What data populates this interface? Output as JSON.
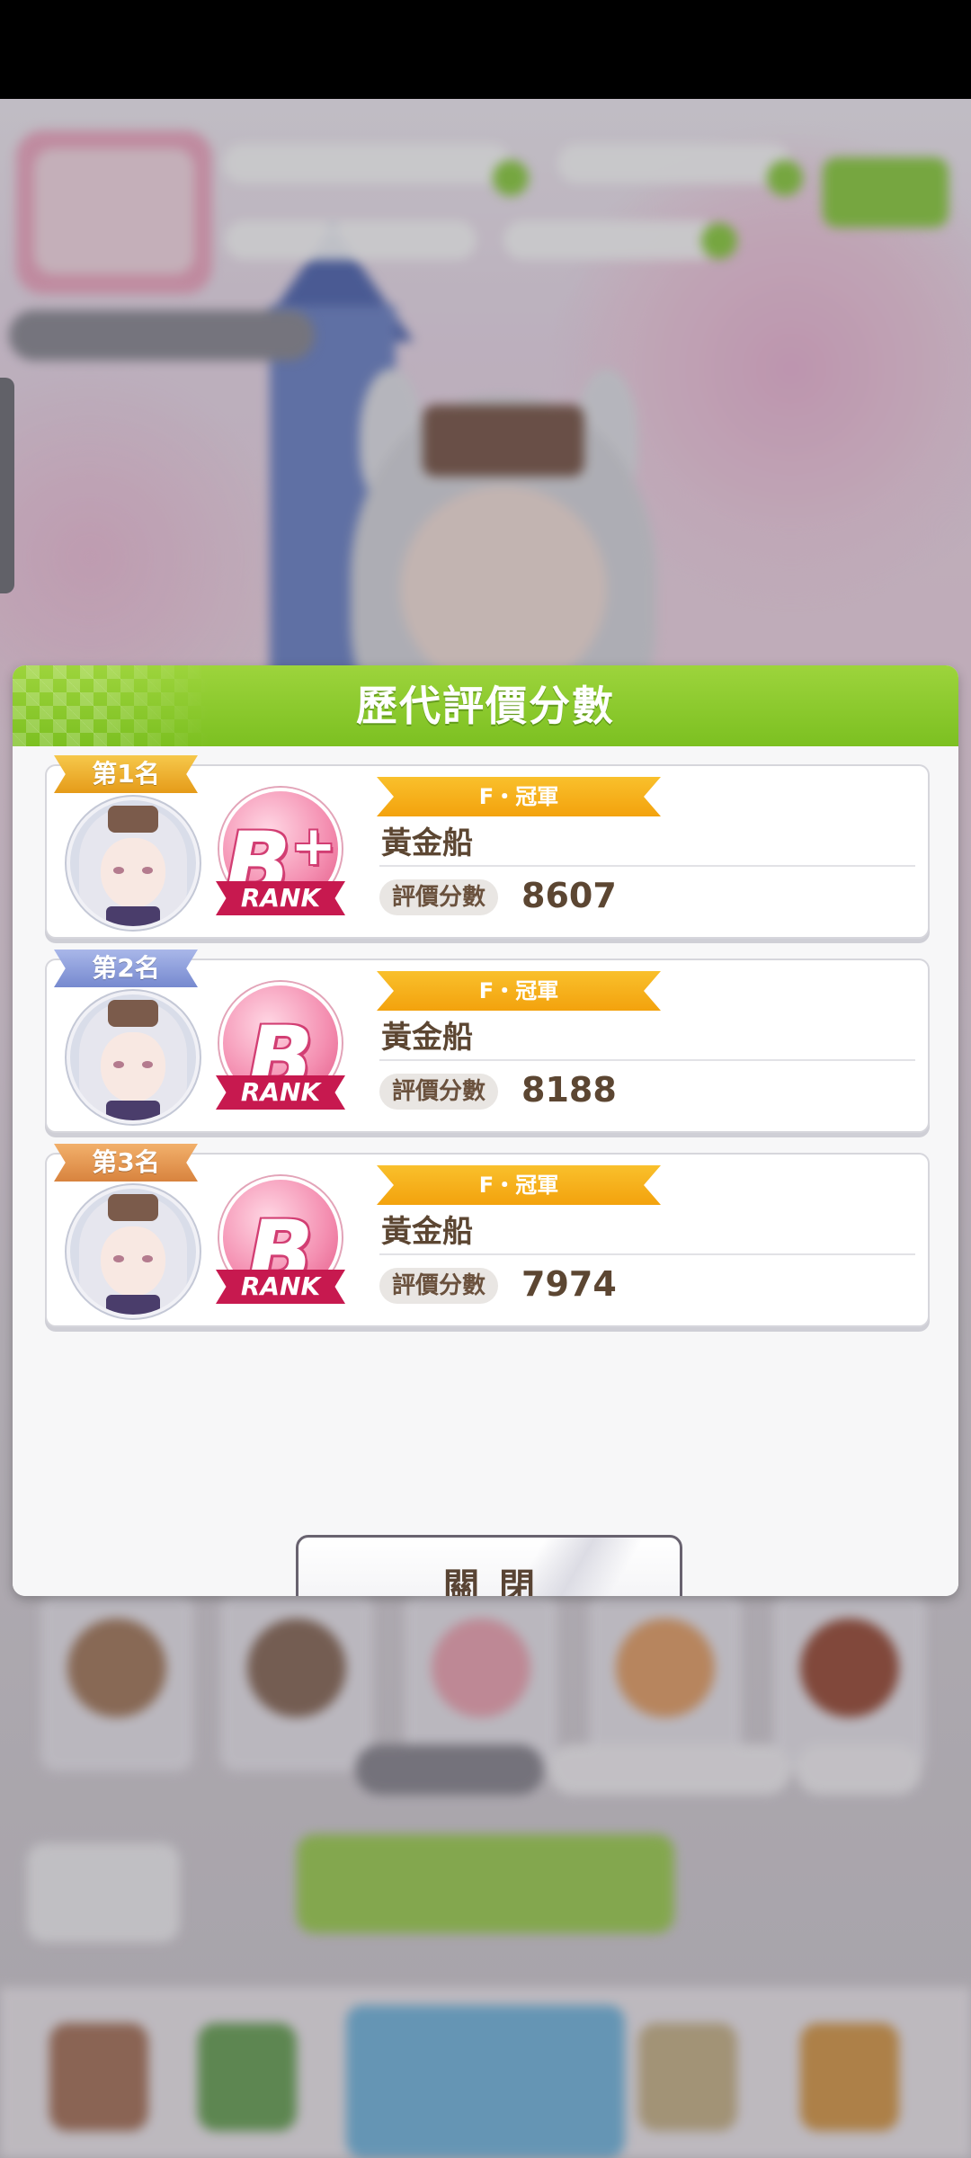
{
  "dialog": {
    "title": "歷代評價分數",
    "close_label": "關閉"
  },
  "records": [
    {
      "place": "第1名",
      "rank": "B",
      "rank_plus": "+",
      "rank_word": "RANK",
      "title": "F・冠軍",
      "name": "黃金船",
      "score_label": "評價分數",
      "score": "8607"
    },
    {
      "place": "第2名",
      "rank": "B",
      "rank_plus": "",
      "rank_word": "RANK",
      "title": "F・冠軍",
      "name": "黃金船",
      "score_label": "評價分數",
      "score": "8188"
    },
    {
      "place": "第3名",
      "rank": "B",
      "rank_plus": "",
      "rank_word": "RANK",
      "title": "F・冠軍",
      "name": "黃金船",
      "score_label": "評價分數",
      "score": "7974"
    }
  ],
  "colors": {
    "header_green": "#7cc021",
    "gold": "#f3a20d",
    "silver": "#7689cf",
    "bronze": "#d8833e",
    "rank_pink": "#e0507f",
    "text_brown": "#5c4632"
  }
}
